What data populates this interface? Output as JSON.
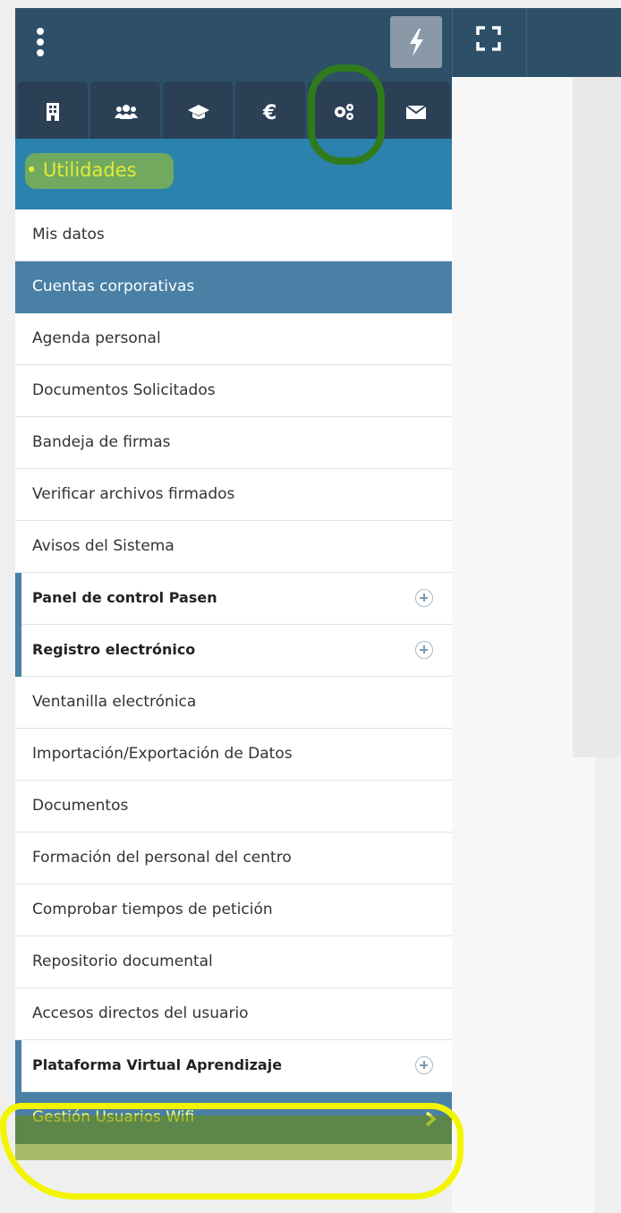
{
  "topbar": {
    "menu_icon": "vertical-dots-icon",
    "quick_icon": "bolt-icon",
    "fullscreen_icon": "fullscreen-icon"
  },
  "tabs": [
    {
      "icon": "building-icon",
      "name": "centro"
    },
    {
      "icon": "users-icon",
      "name": "personal"
    },
    {
      "icon": "graduation-cap-icon",
      "name": "alumnado"
    },
    {
      "icon": "euro-icon",
      "name": "gestion-economica"
    },
    {
      "icon": "gears-icon",
      "name": "utilidades"
    },
    {
      "icon": "envelope-icon",
      "name": "mensajes"
    }
  ],
  "section": {
    "title": "• Utilidades"
  },
  "menu": {
    "items": [
      {
        "label": "Mis datos"
      },
      {
        "label": "Cuentas corporativas"
      },
      {
        "label": "Agenda personal"
      },
      {
        "label": "Documentos Solicitados"
      },
      {
        "label": "Bandeja de firmas"
      },
      {
        "label": "Verificar archivos firmados"
      },
      {
        "label": "Avisos del Sistema"
      },
      {
        "label": "Panel de control Pasen"
      },
      {
        "label": "Registro electrónico"
      },
      {
        "label": "Ventanilla electrónica"
      },
      {
        "label": "Importación/Exportación de Datos"
      },
      {
        "label": "Documentos"
      },
      {
        "label": "Formación del personal del centro"
      },
      {
        "label": "Comprobar tiempos de petición"
      },
      {
        "label": "Repositorio documental"
      },
      {
        "label": "Accesos directos del usuario"
      },
      {
        "label": "Plataforma Virtual Aprendizaje"
      },
      {
        "label": "Gestión Usuarios Wifi"
      }
    ]
  },
  "colors": {
    "topbar": "#2d4f68",
    "section_header": "#2a82ad",
    "active_item": "#4a80a5",
    "highlight": "#f3f500"
  }
}
